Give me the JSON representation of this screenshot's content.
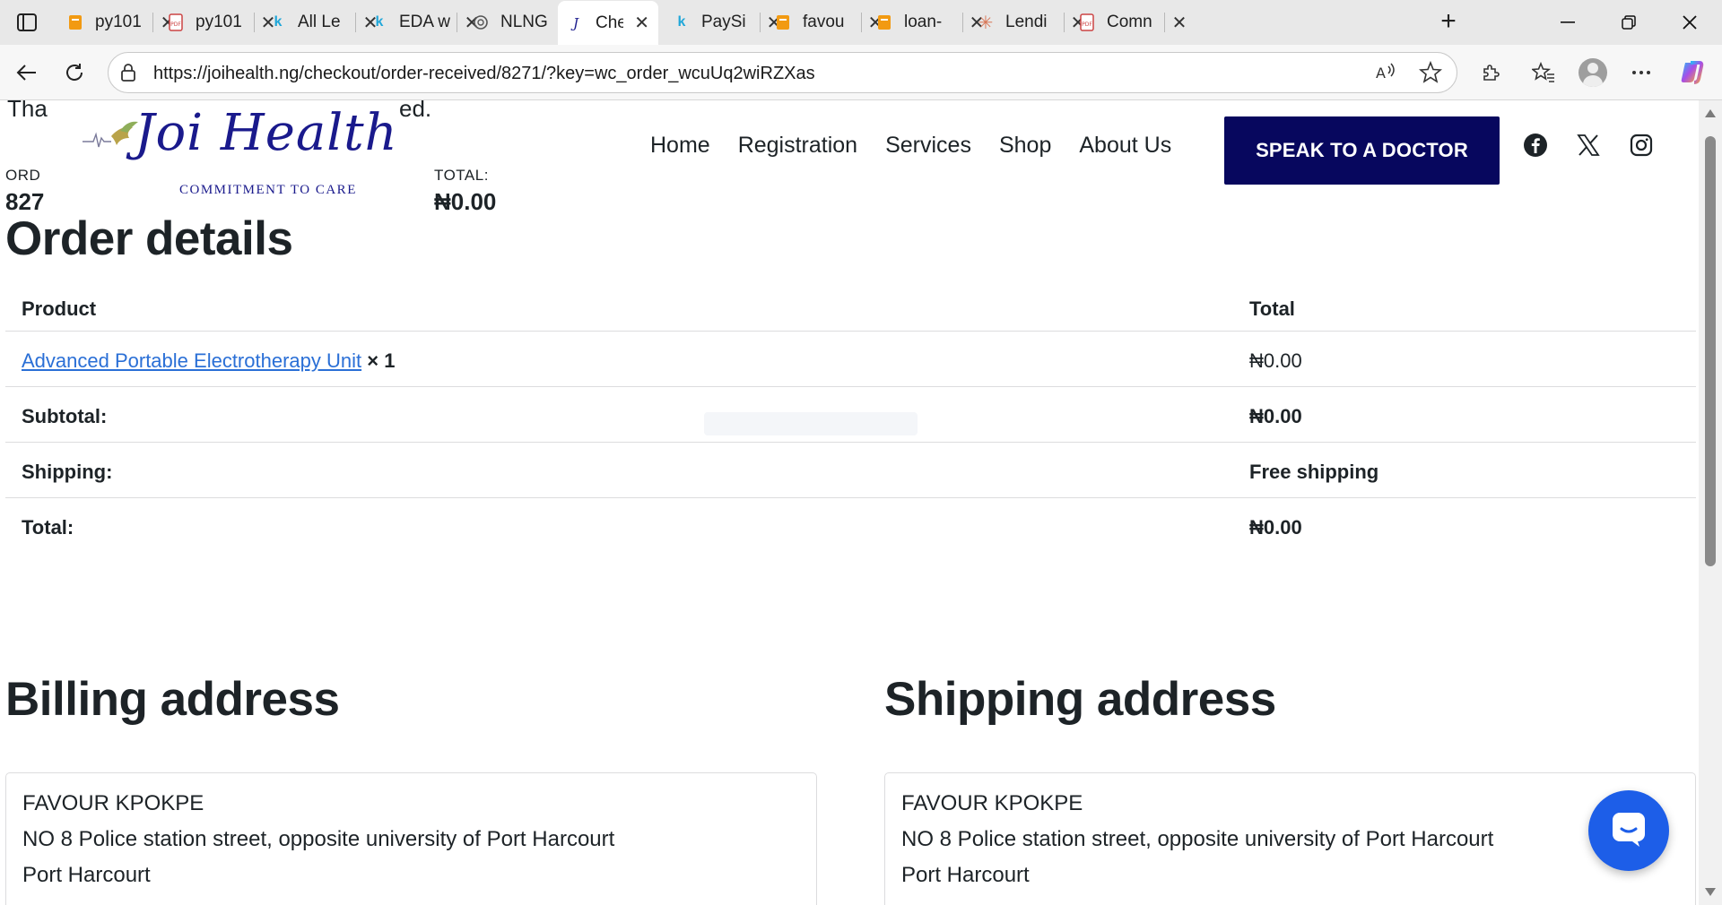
{
  "browser": {
    "tabs": [
      {
        "favicon": "pages-doc-icon",
        "title": "py101",
        "active": false
      },
      {
        "favicon": "pdf-icon",
        "title": "py101",
        "active": false
      },
      {
        "favicon": "k-logo-icon",
        "title": "All Le",
        "active": false
      },
      {
        "favicon": "k-logo-icon",
        "title": "EDA w",
        "active": false
      },
      {
        "favicon": "openai-icon",
        "title": "NLNG",
        "active": false
      },
      {
        "favicon": "joi-logo-icon",
        "title": "Check",
        "active": true
      },
      {
        "favicon": "k-logo-icon",
        "title": "PaySi",
        "active": false
      },
      {
        "favicon": "pages-doc-icon",
        "title": "favou",
        "active": false
      },
      {
        "favicon": "pages-doc-icon",
        "title": "loan-",
        "active": false
      },
      {
        "favicon": "claude-icon",
        "title": "Lendi",
        "active": false
      },
      {
        "favicon": "pdf-icon",
        "title": "Comn",
        "active": false
      }
    ],
    "url": "https://joihealth.ng/checkout/order-received/8271/?key=wc_order_wcuUq2wiRZXas"
  },
  "page": {
    "under": {
      "thanks_left": "Tha",
      "thanks_right": "ed.",
      "order_label": "ORD",
      "order_value": "827",
      "total_label": "TOTAL:",
      "total_value": "₦0.00"
    },
    "header": {
      "logo_text": "Joi Health",
      "logo_tagline": "COMMITMENT TO CARE",
      "nav": [
        "Home",
        "Registration",
        "Services",
        "Shop",
        "About Us"
      ],
      "cta": "SPEAK TO A DOCTOR",
      "social": [
        "facebook-icon",
        "x-twitter-icon",
        "instagram-icon"
      ]
    },
    "order_details": {
      "heading": "Order details",
      "columns": {
        "product": "Product",
        "total": "Total"
      },
      "item": {
        "name": "Advanced Portable Electrotherapy Unit",
        "qty": "× 1",
        "total": "₦0.00"
      },
      "subtotal": {
        "label": "Subtotal:",
        "value": "₦0.00"
      },
      "shipping": {
        "label": "Shipping:",
        "value": "Free shipping"
      },
      "total": {
        "label": "Total:",
        "value": "₦0.00"
      }
    },
    "billing": {
      "heading": "Billing address",
      "lines": [
        "FAVOUR KPOKPE",
        "NO 8 Police station street, opposite university of Port Harcourt",
        "Port Harcourt"
      ]
    },
    "shipping_address": {
      "heading": "Shipping address",
      "lines": [
        "FAVOUR KPOKPE",
        "NO 8 Police station street, opposite university of Port Harcourt",
        "Port Harcourt"
      ]
    }
  },
  "colors": {
    "brand_navy": "#07075e",
    "link_blue": "#2a6fd6",
    "chat_blue": "#1d5ee8"
  }
}
